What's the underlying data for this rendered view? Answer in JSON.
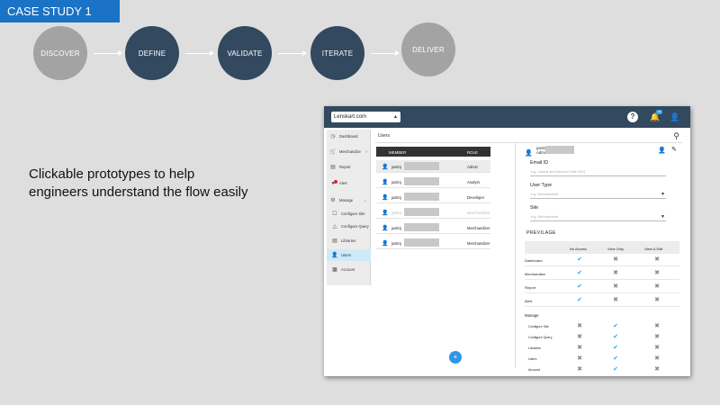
{
  "case_study": "CASE STUDY 1",
  "steps": [
    {
      "label": "DISCOVER",
      "state": "grey"
    },
    {
      "label": "DEFINE",
      "state": "dark"
    },
    {
      "label": "VALIDATE",
      "state": "dark"
    },
    {
      "label": "ITERATE",
      "state": "dark"
    },
    {
      "label": "DELIVER",
      "state": "grey"
    }
  ],
  "caption": [
    "Clickable prototypes to help",
    "engineers understand the flow easily"
  ],
  "app": {
    "site_select": "Lenskart.com",
    "notification_count": "34",
    "icons": {
      "help": "help-icon",
      "bell": "bell-icon",
      "user": "user-icon",
      "search": "search-icon",
      "add": "plus-icon"
    },
    "colors": {
      "topbar": "#33495f",
      "accent": "#2ea6e8",
      "fab": "#2d97e6"
    },
    "sidebar": [
      {
        "label": "Dashboard",
        "icon": "dashboard-icon"
      },
      {
        "label": "Merchandize",
        "icon": "cart-icon"
      },
      {
        "label": "Report",
        "icon": "report-icon"
      },
      {
        "label": "Alert",
        "icon": "alert-icon"
      },
      {
        "label": "Manage",
        "icon": "gear-icon"
      },
      {
        "label": "Configure Site",
        "icon": "configure-site-icon"
      },
      {
        "label": "Configure Query",
        "icon": "configure-query-icon"
      },
      {
        "label": "Libraries",
        "icon": "libraries-icon"
      },
      {
        "label": "Users",
        "icon": "users-icon"
      },
      {
        "label": "Account",
        "icon": "account-icon"
      }
    ],
    "page_title": "Users",
    "list_headers": {
      "member": "MEMBER",
      "role": "ROLE"
    },
    "members": [
      {
        "name": "justinj",
        "role": "Admin",
        "state": "selected"
      },
      {
        "name": "justinj",
        "role": "Analyst",
        "state": "normal"
      },
      {
        "name": "justinj",
        "role": "Developer",
        "state": "normal"
      },
      {
        "name": "justinj",
        "role": "Merchandizer",
        "state": "disabled"
      },
      {
        "name": "justinj",
        "role": "Merchandizer",
        "state": "normal"
      },
      {
        "name": "justinj",
        "role": "Merchandizer",
        "state": "normal"
      }
    ],
    "detail": {
      "name": "justinj",
      "role": "Admin",
      "email_label": "Email ID",
      "email_placeholder": "e.g. Casual and Summer Sale 2019",
      "user_type_label": "User Type",
      "user_type_placeholder": "e.g. Merchandizer",
      "site_label": "Site",
      "site_placeholder": "e.g. Merchandizer",
      "privilege_title": "PREVILAGE",
      "columns": [
        "No Access",
        "View Only",
        "View & Edit"
      ],
      "permissions": [
        {
          "name": "Dashboard",
          "values": [
            "check",
            "cross",
            "cross"
          ]
        },
        {
          "name": "Merchandize",
          "values": [
            "check",
            "cross",
            "cross"
          ]
        },
        {
          "name": "Report",
          "values": [
            "check",
            "cross",
            "cross"
          ]
        },
        {
          "name": "Alert",
          "values": [
            "check",
            "cross",
            "cross"
          ]
        }
      ],
      "manage_label": "Manage",
      "manage_permissions": [
        {
          "name": "Configure Site",
          "values": [
            "cross",
            "check",
            "cross"
          ]
        },
        {
          "name": "Configure Query",
          "values": [
            "cross",
            "check",
            "cross"
          ]
        },
        {
          "name": "Libraries",
          "values": [
            "cross",
            "check",
            "cross"
          ]
        },
        {
          "name": "Users",
          "values": [
            "cross",
            "check",
            "cross"
          ]
        },
        {
          "name": "Account",
          "values": [
            "cross",
            "check",
            "cross"
          ]
        }
      ]
    }
  }
}
